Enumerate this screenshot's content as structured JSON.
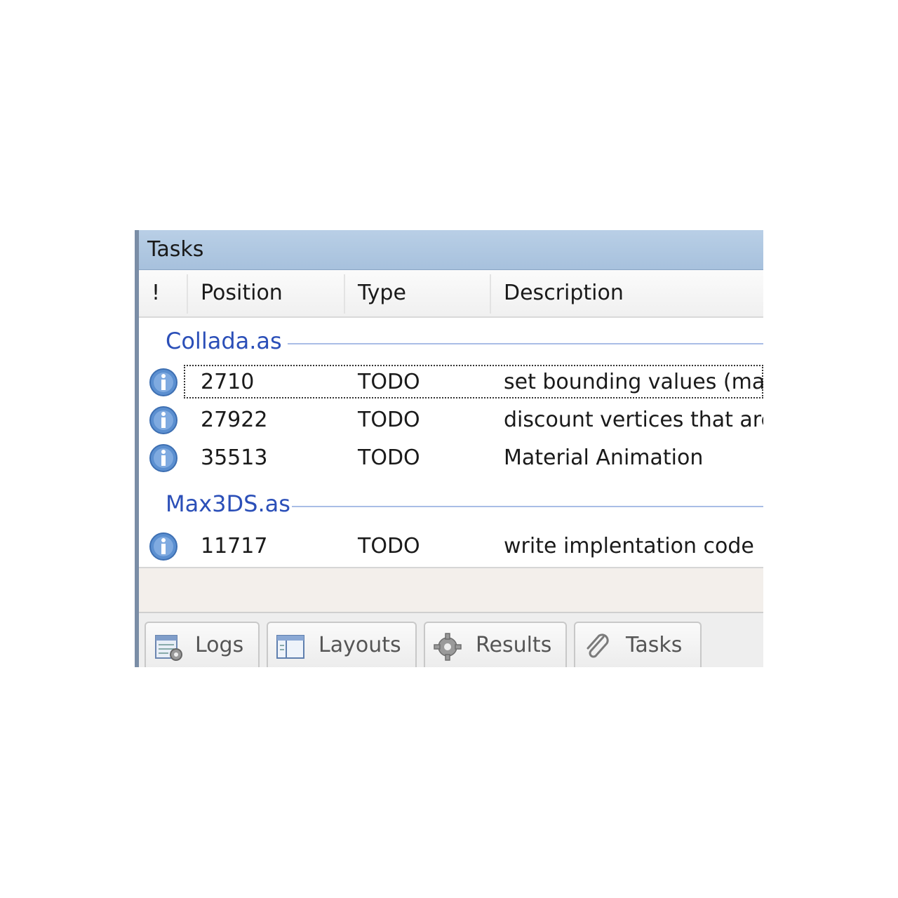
{
  "panel": {
    "title": "Tasks"
  },
  "columns": [
    {
      "label": "!"
    },
    {
      "label": "Position"
    },
    {
      "label": "Type"
    },
    {
      "label": "Description"
    }
  ],
  "groups": [
    {
      "file": "Collada.as",
      "tasks": [
        {
          "icon": "info-icon",
          "position": "2710",
          "type": "TODO",
          "description": "set bounding values (max"
        },
        {
          "icon": "info-icon",
          "position": "27922",
          "type": "TODO",
          "description": "discount vertices that are"
        },
        {
          "icon": "info-icon",
          "position": "35513",
          "type": "TODO",
          "description": "Material Animation"
        }
      ]
    },
    {
      "file": "Max3DS.as",
      "tasks": [
        {
          "icon": "info-icon",
          "position": "11717",
          "type": "TODO",
          "description": "write implentation code"
        }
      ]
    }
  ],
  "tabs": [
    {
      "label": "Logs",
      "icon": "logs-icon"
    },
    {
      "label": "Layouts",
      "icon": "layouts-icon"
    },
    {
      "label": "Results",
      "icon": "gear-icon"
    },
    {
      "label": "Tasks",
      "icon": "paperclip-icon"
    }
  ],
  "colors": {
    "titlebar": "#b9cfe6",
    "group_label": "#2b4fb8",
    "group_rule": "#a9bde6",
    "info_icon": "#5b8fd0"
  }
}
